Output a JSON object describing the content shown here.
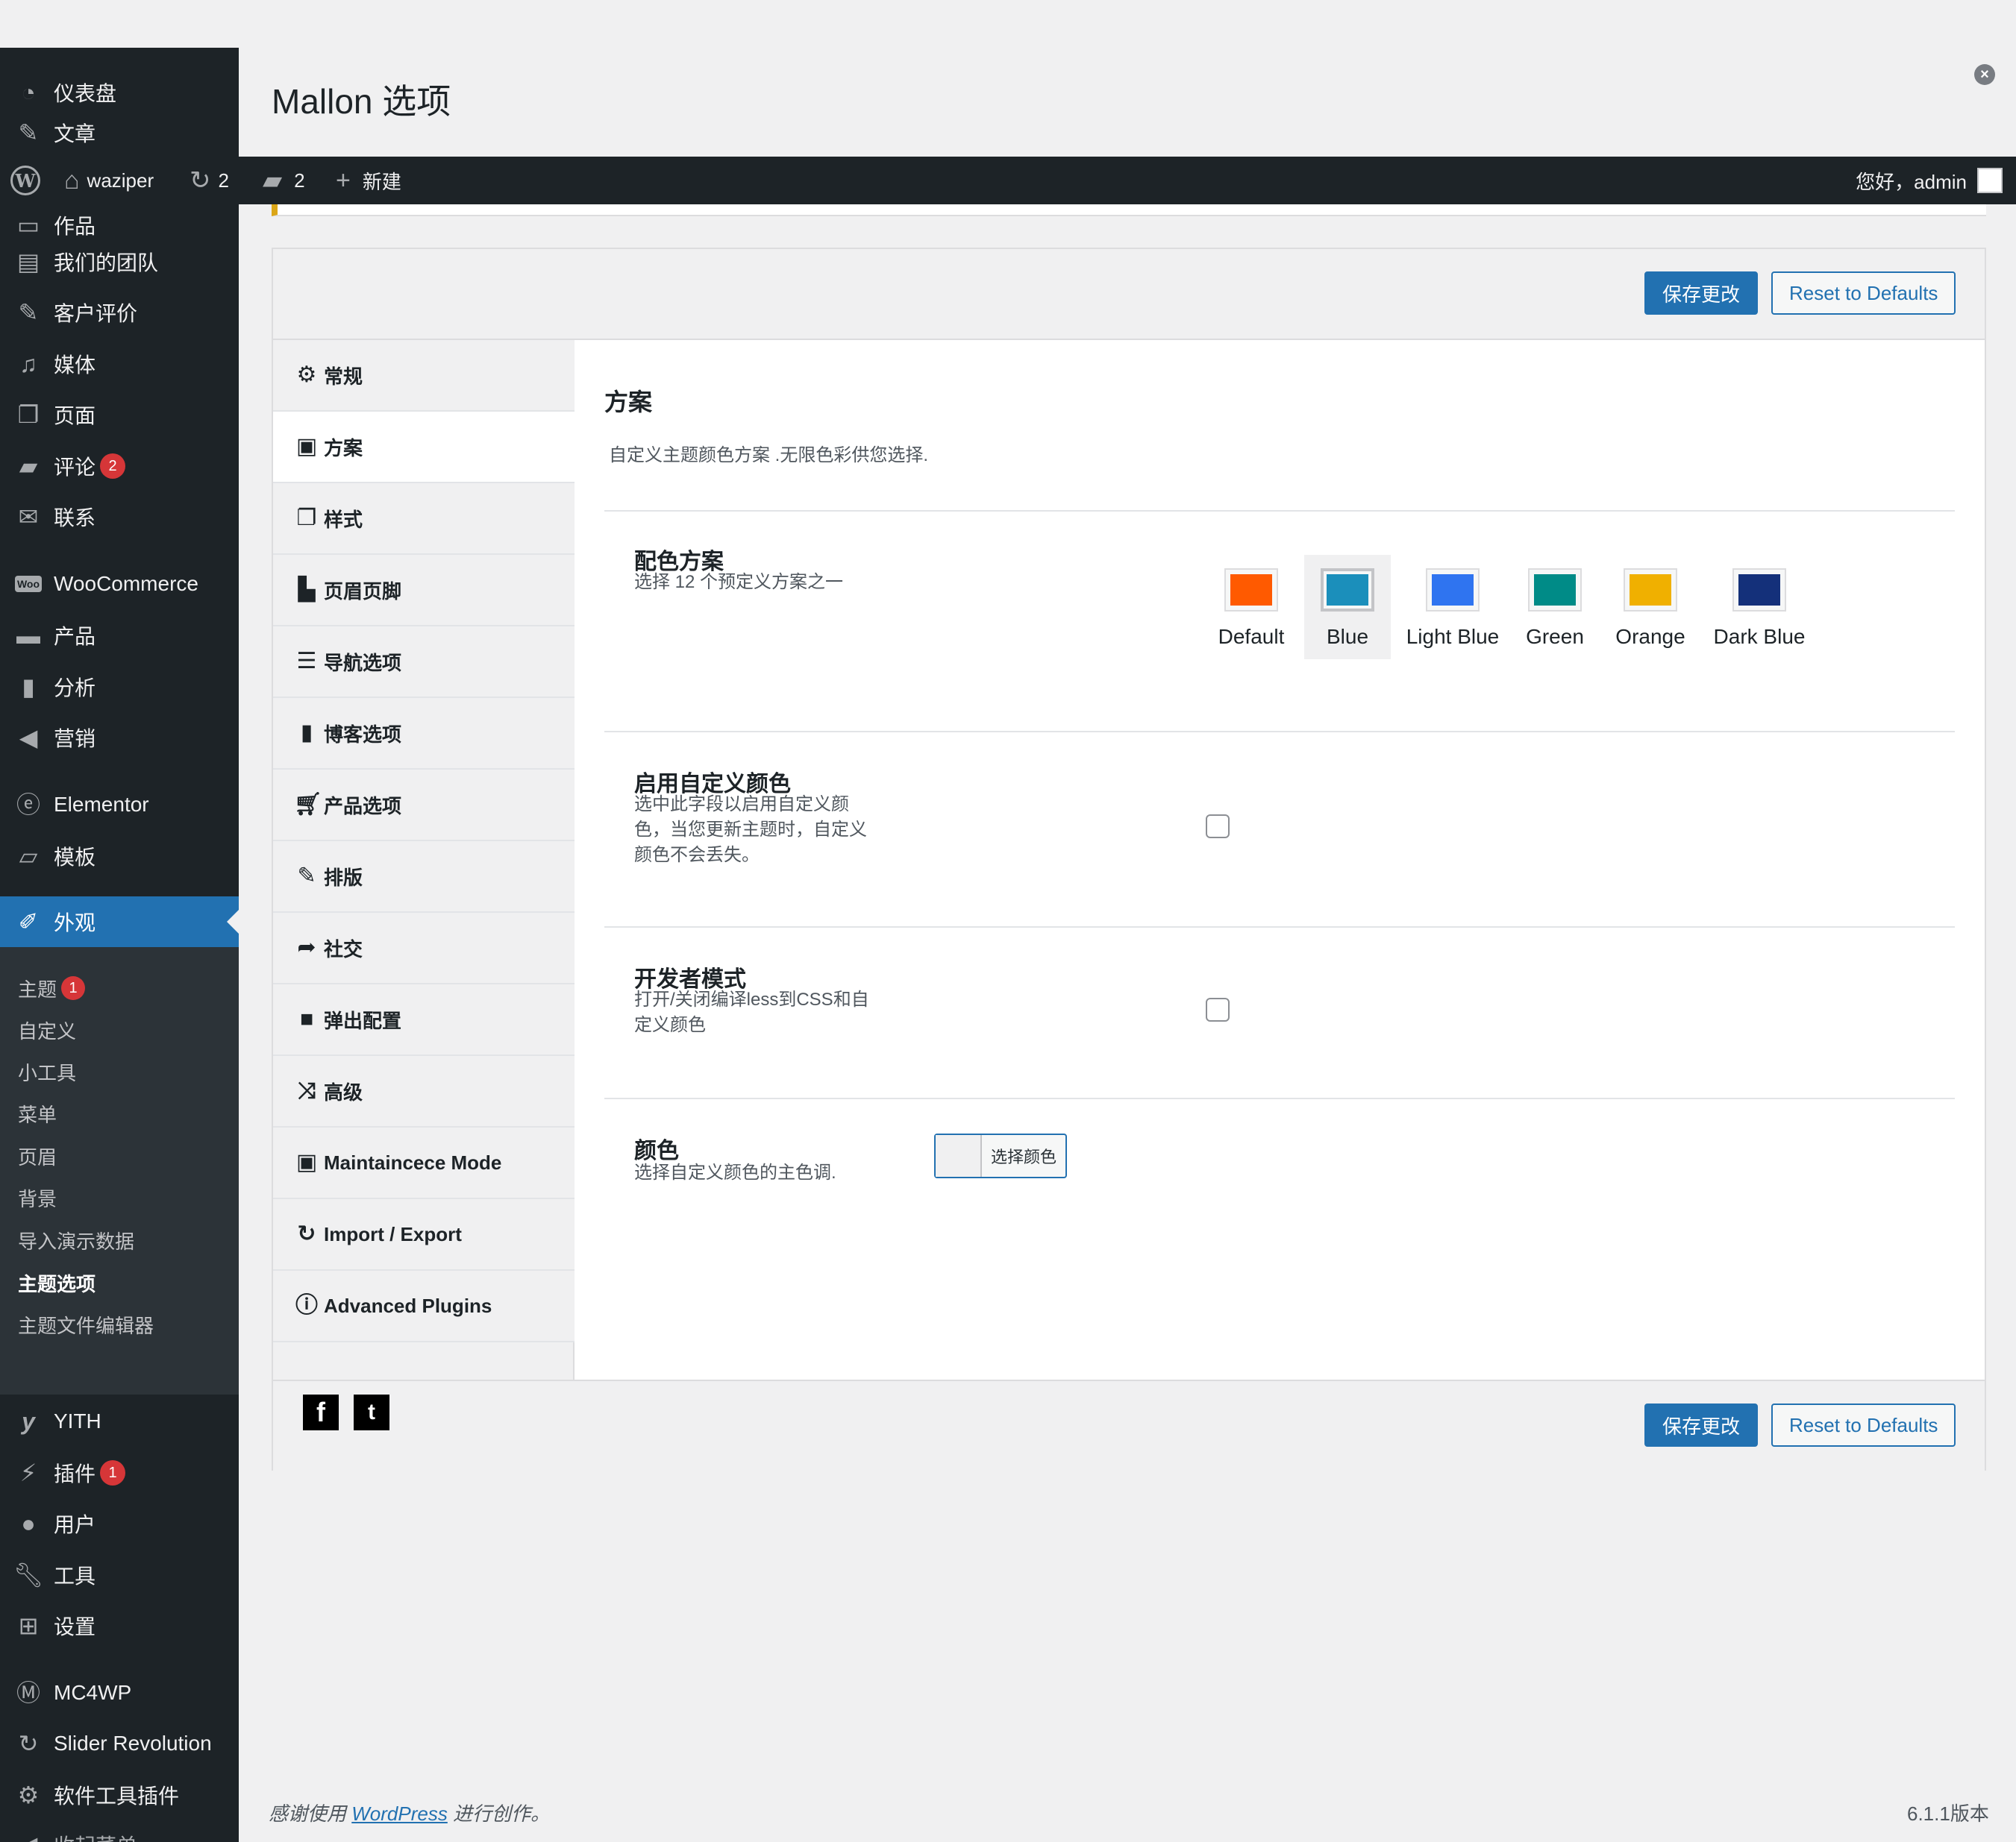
{
  "page": {
    "title": "Mallon 选项"
  },
  "admin_bar": {
    "site_name": "waziper",
    "updates_count": "2",
    "comments_count": "2",
    "new_label": "新建",
    "greeting": "您好，admin"
  },
  "sidebar": {
    "items": [
      {
        "label": "仪表盘",
        "icon": "dashboard-icon"
      },
      {
        "label": "文章",
        "icon": "pin-icon"
      },
      {
        "label": "作品",
        "icon": "portfolio-icon"
      },
      {
        "label": "我们的团队",
        "icon": "id-card-icon"
      },
      {
        "label": "客户评价",
        "icon": "edit-icon"
      },
      {
        "label": "媒体",
        "icon": "media-icon"
      },
      {
        "label": "页面",
        "icon": "page-icon"
      },
      {
        "label": "评论",
        "icon": "comment-icon",
        "badge": "2"
      },
      {
        "label": "联系",
        "icon": "mail-icon"
      },
      {
        "label": "WooCommerce",
        "icon": "woo-icon"
      },
      {
        "label": "产品",
        "icon": "archive-icon"
      },
      {
        "label": "分析",
        "icon": "bar-chart-icon"
      },
      {
        "label": "营销",
        "icon": "megaphone-icon"
      },
      {
        "label": "Elementor",
        "icon": "elementor-icon"
      },
      {
        "label": "模板",
        "icon": "folder-icon"
      },
      {
        "label": "外观",
        "icon": "paintbrush-icon"
      },
      {
        "label": "YITH",
        "icon": "yith-icon"
      },
      {
        "label": "插件",
        "icon": "plugin-icon",
        "badge": "1"
      },
      {
        "label": "用户",
        "icon": "user-icon"
      },
      {
        "label": "工具",
        "icon": "wrench-icon"
      },
      {
        "label": "设置",
        "icon": "settings-icon"
      },
      {
        "label": "MC4WP",
        "icon": "mc4wp-icon"
      },
      {
        "label": "Slider Revolution",
        "icon": "refresh-icon"
      },
      {
        "label": "软件工具插件",
        "icon": "gear-icon"
      },
      {
        "label": "收起菜单",
        "icon": "collapse-icon"
      }
    ],
    "submenu": [
      {
        "label": "主题",
        "badge": "1"
      },
      {
        "label": "自定义"
      },
      {
        "label": "小工具"
      },
      {
        "label": "菜单"
      },
      {
        "label": "页眉"
      },
      {
        "label": "背景"
      },
      {
        "label": "导入演示数据"
      },
      {
        "label": "主题选项"
      },
      {
        "label": "主题文件编辑器"
      }
    ]
  },
  "panel": {
    "save_label": "保存更改",
    "reset_label": "Reset to Defaults",
    "nav": [
      {
        "label": "常规",
        "icon": "gear-icon"
      },
      {
        "label": "方案",
        "icon": "screen-icon"
      },
      {
        "label": "样式",
        "icon": "copy-icon"
      },
      {
        "label": "页眉页脚",
        "icon": "header-footer-icon"
      },
      {
        "label": "导航选项",
        "icon": "hamburger-icon"
      },
      {
        "label": "博客选项",
        "icon": "book-icon"
      },
      {
        "label": "产品选项",
        "icon": "cart-icon"
      },
      {
        "label": "排版",
        "icon": "edit-icon"
      },
      {
        "label": "社交",
        "icon": "share-icon"
      },
      {
        "label": "弹出配置",
        "icon": "square-icon"
      },
      {
        "label": "高级",
        "icon": "shuffle-icon"
      },
      {
        "label": "Maintaincece Mode",
        "icon": "lock-icon"
      },
      {
        "label": "Import / Export",
        "icon": "refresh-icon"
      },
      {
        "label": "Advanced Plugins",
        "icon": "info-icon"
      }
    ],
    "section": {
      "title": "方案",
      "description": "自定义主题颜色方案 .无限色彩供您选择.",
      "color_scheme": {
        "label": "配色方案",
        "description": "选择 12 个预定义方案之一",
        "selected": "Blue",
        "swatches": [
          {
            "name": "Default",
            "color": "#ff5a00"
          },
          {
            "name": "Blue",
            "color": "#1b8fbb"
          },
          {
            "name": "Light Blue",
            "color": "#2f74f0"
          },
          {
            "name": "Green",
            "color": "#008b87"
          },
          {
            "name": "Orange",
            "color": "#f0b000"
          },
          {
            "name": "Dark Blue",
            "color": "#14307a"
          }
        ]
      },
      "custom_color": {
        "label": "启用自定义颜色",
        "description": "选中此字段以启用自定义颜色，当您更新主题时，自定义颜色不会丢失。",
        "checked": false
      },
      "dev_mode": {
        "label": "开发者模式",
        "description": "打开/关闭编译less到CSS和自定义颜色",
        "checked": false
      },
      "color": {
        "label": "颜色",
        "description": "选择自定义颜色的主色调.",
        "button_label": "选择颜色"
      }
    },
    "social": [
      {
        "name": "facebook-icon",
        "glyph": "f"
      },
      {
        "name": "twitter-icon",
        "glyph": "t"
      }
    ]
  },
  "footer": {
    "thanks_prefix": "感谢使用",
    "thanks_link": "WordPress",
    "thanks_suffix": "进行创作。",
    "version": "6.1.1版本"
  },
  "colors": {
    "accent": "#2271b1",
    "sidebar_bg": "#1d2327",
    "badge": "#d63638"
  }
}
